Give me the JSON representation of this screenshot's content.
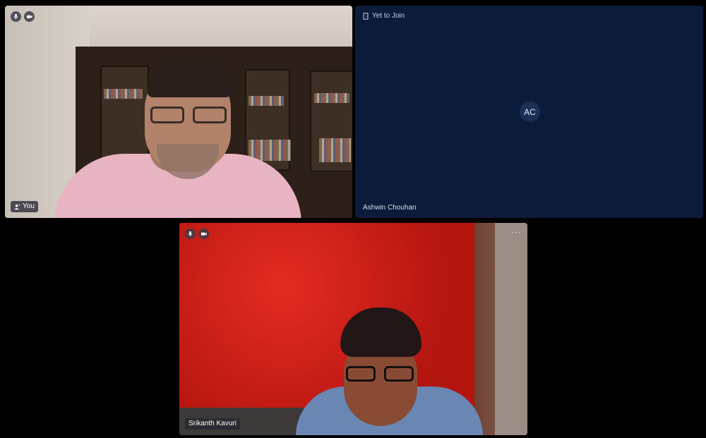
{
  "tiles": {
    "you": {
      "name": "You",
      "controls": [
        "microphone-icon",
        "camera-icon"
      ]
    },
    "ashwin": {
      "status": "Yet to Join",
      "initials": "AC",
      "name": "Ashwin Chouhan",
      "background": "#0c1b3a"
    },
    "srikanth": {
      "name": "Srikanth Kavuri",
      "more": "···",
      "controls": [
        "microphone-icon",
        "camera-icon"
      ]
    }
  }
}
